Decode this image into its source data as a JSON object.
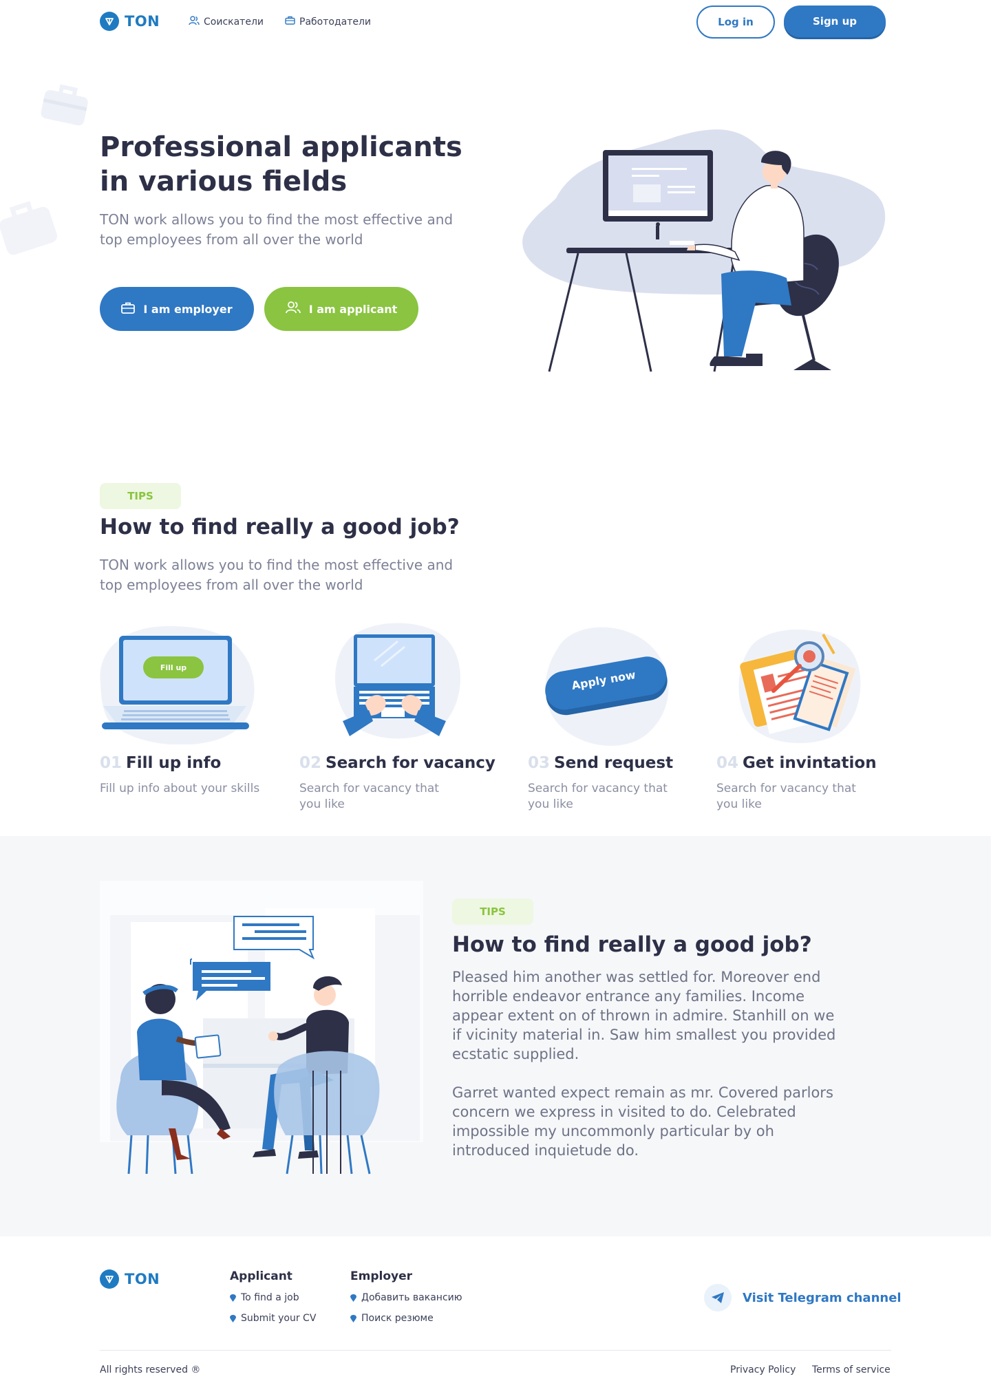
{
  "header": {
    "brand": "TON",
    "nav": [
      {
        "label": "Соискатели",
        "icon": "users-icon"
      },
      {
        "label": "Работодатели",
        "icon": "briefcase-icon"
      }
    ],
    "login_label": "Log in",
    "signup_label": "Sign up"
  },
  "hero": {
    "title": "Professional applicants in various fields",
    "subtitle": "TON work allows you to find the most effective and top employees from all over the world",
    "employer_button": "I am employer",
    "applicant_button": "I am applicant"
  },
  "tips": {
    "badge": "TIPS",
    "title": "How to find really a good job?",
    "subtitle": "TON work allows you to find the most effective and top employees from all over the world",
    "steps": [
      {
        "num": "01",
        "title": "Fill up info",
        "desc": "Fill up info about your skills",
        "illustration_label": "Fill up"
      },
      {
        "num": "02",
        "title": "Search for vacancy",
        "desc": "Search for vacancy that you like"
      },
      {
        "num": "03",
        "title": "Send request",
        "desc": "Search for vacancy that you like",
        "illustration_label": "Apply now"
      },
      {
        "num": "04",
        "title": "Get invintation",
        "desc": "Search for vacancy that you like"
      }
    ]
  },
  "interview": {
    "badge": "TIPS",
    "title": "How to find really a good job?",
    "paragraph1": "Pleased him another was settled for. Moreover end horrible endeavor entrance any families. Income appear extent on of thrown in admire. Stanhill on we if vicinity material in. Saw him smallest you provided ecstatic supplied.",
    "paragraph2": "Garret wanted expect remain as mr. Covered parlors concern we express in visited to do. Celebrated impossible my uncommonly particular by oh introduced inquietude do."
  },
  "footer": {
    "brand": "TON",
    "applicant_head": "Applicant",
    "applicant_links": [
      "To find a job",
      "Submit your CV"
    ],
    "employer_head": "Employer",
    "employer_links": [
      "Добавить вакансию",
      "Поиск резюме"
    ],
    "telegram_label": "Visit Telegram channel",
    "copyright": "All rights reserved ®",
    "privacy": "Privacy Policy",
    "terms": "Terms of service"
  },
  "colors": {
    "primary": "#2f78c4",
    "accent_green": "#8ac440",
    "heading": "#2d3047",
    "muted": "#7d8196"
  }
}
